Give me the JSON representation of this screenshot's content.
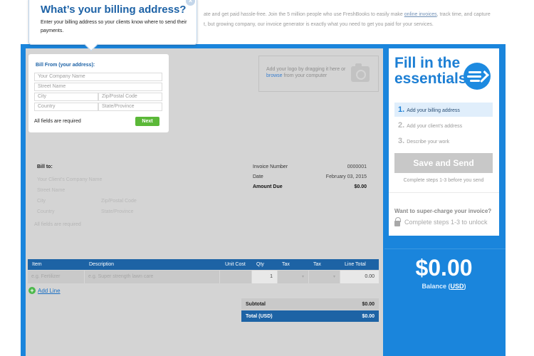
{
  "intro": {
    "line1_start": "ate and get paid hassle-free. Join the 5 million people who use FreshBooks to easily make ",
    "line1_link": "online invoices",
    "line1_end": ", track time, and capture",
    "line2": "t, but growing company, our invoice generator is exactly what you need to get you paid for your services."
  },
  "callout": {
    "title": "What’s your billing address?",
    "body": "Enter your billing address so your clients know where to send their payments.",
    "close": "×"
  },
  "bill_from": {
    "title": "Bill From (your address):",
    "company_placeholder": "Your Company Name",
    "street_placeholder": "Street Name",
    "city_placeholder": "City",
    "zip_placeholder": "Zip/Postal Code",
    "country_placeholder": "Country",
    "state_placeholder": "State/Province",
    "required_note": "All fields are required",
    "next_label": "Next"
  },
  "logo": {
    "text_start": "Add your logo by dragging it here or ",
    "browse_link": "browse",
    "text_end": " from your computer"
  },
  "bill_to": {
    "title": "Bill to:",
    "company": "Your Client's Company Name",
    "street": "Street Name",
    "city": "City",
    "zip": "Zip/Postal Code",
    "country": "Country",
    "state": "State/Province",
    "required_note": "All fields are required"
  },
  "invoice_meta": {
    "number_label": "Invoice Number",
    "number_value": "0000001",
    "date_label": "Date",
    "date_value": "February 03, 2015",
    "amount_label": "Amount Due",
    "amount_value": "$0.00"
  },
  "items": {
    "headers": [
      "Item",
      "Description",
      "Unit Cost",
      "Qty",
      "Tax",
      "Tax",
      "Line Total"
    ],
    "row": {
      "item_placeholder": "e.g. Fertilizer",
      "desc_placeholder": "e.g. Super strength lawn care",
      "unit_cost": "",
      "qty": "1",
      "tax1": "",
      "tax2": "",
      "line_total": "0.00"
    },
    "add_line": "Add Line"
  },
  "totals": {
    "subtotal_label": "Subtotal",
    "subtotal_value": "$0.00",
    "total_label": "Total (USD)",
    "total_value": "$0.00"
  },
  "panel": {
    "title": "Fill in the essentials",
    "steps": [
      {
        "num": "1.",
        "label": "Add your billing address"
      },
      {
        "num": "2.",
        "label": "Add your client's address"
      },
      {
        "num": "3.",
        "label": "Describe your work"
      }
    ],
    "save_label": "Save and Send",
    "complete_note": "Complete steps 1-3 before you send",
    "super_title": "Want to super-charge your invoice?",
    "unlock_note": "Complete steps 1-3 to unlock"
  },
  "balance": {
    "amount": "$0.00",
    "label_start": "Balance (",
    "currency": "USD",
    "label_end": ")"
  },
  "colors": {
    "brand_blue": "#1a85dc",
    "header_blue": "#1d63a5",
    "next_green": "#5bb838"
  }
}
